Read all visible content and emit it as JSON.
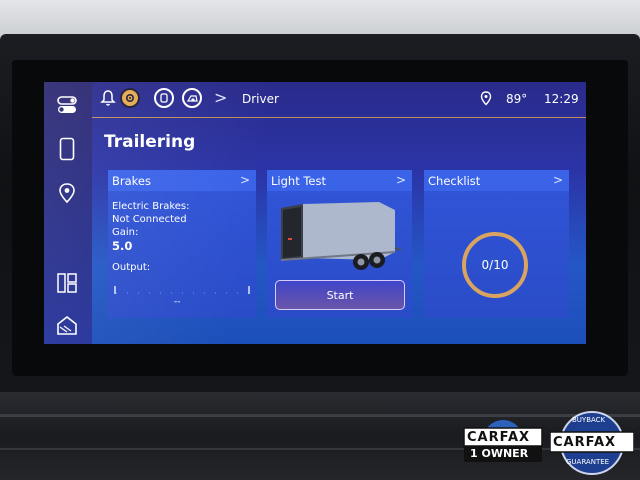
{
  "topbar": {
    "breadcrumb_arrow": ">",
    "profile": "Driver",
    "temperature": "89°",
    "time": "12:29"
  },
  "page": {
    "title": "Trailering"
  },
  "cards": {
    "brakes": {
      "header": "Brakes",
      "line1": "Electric Brakes:",
      "line2": "Not Connected",
      "line3": "Gain:",
      "gain_value": "5.0",
      "output_label": "Output:",
      "output_value": "--"
    },
    "light_test": {
      "header": "Light Test",
      "start_label": "Start"
    },
    "checklist": {
      "header": "Checklist",
      "progress": "0/10",
      "progress_fraction": 0
    }
  },
  "chevron": ">",
  "badges": {
    "carfax_top": "CARFAX",
    "carfax_owner": "1 OWNER",
    "carfax2_top": "CARFAX",
    "buyback_text": "BUYBACK",
    "guarantee_text": "GUARANTEE"
  },
  "icons": [
    "settings-toggle-icon",
    "phone-icon",
    "location-pin-icon",
    "widgets-icon",
    "home-icon",
    "bell-icon",
    "driver-assist-icon",
    "seat-icon",
    "wheel-icon",
    "location-pin-icon"
  ],
  "colors": {
    "accent": "#e6a84f",
    "card_head": "#3a63e8",
    "ring": "#d9a460"
  }
}
